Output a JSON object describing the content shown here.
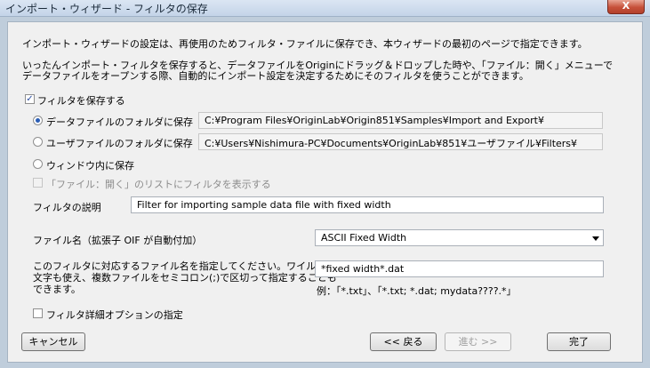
{
  "window": {
    "title": "インポート・ウィザード - フィルタの保存",
    "close_glyph": "X"
  },
  "intro": {
    "line1": "インポート・ウィザードの設定は、再使用のためフィルタ・ファイルに保存でき、本ウィザードの最初のページで指定できます。",
    "line2": "いったんインポート・フィルタを保存すると、データファイルをOriginにドラッグ＆ドロップした時や、「ファイル：開く」メニューで",
    "line3": "データファイルをオープンする際、自動的にインポート設定を決定するためにそのフィルタを使うことができます。"
  },
  "save_filter": {
    "label": "フィルタを保存する",
    "checked": true
  },
  "locations": [
    {
      "label": "データファイルのフォルダに保存",
      "path": "C:¥Program Files¥OriginLab¥Origin851¥Samples¥Import and Export¥",
      "selected": true
    },
    {
      "label": "ユーザファイルのフォルダに保存",
      "path": "C:¥Users¥Nishimura-PC¥Documents¥OriginLab¥851¥ユーザファイル¥Filters¥",
      "selected": false
    },
    {
      "label": "ウィンドウ内に保存",
      "selected": false
    }
  ],
  "show_in_open_list": {
    "label": "「ファイル：開く」のリストにフィルタを表示する",
    "checked": false,
    "enabled": false
  },
  "description": {
    "label": "フィルタの説明",
    "value": "Filter for importing sample data file with fixed width"
  },
  "filename": {
    "label": "ファイル名（拡張子 OIF が自動付加）",
    "value": "ASCII Fixed Width"
  },
  "filename_spec": {
    "help1": "このフィルタに対応するファイル名を指定してください。ワイルドカード",
    "help2": "文字も使え、複数ファイルをセミコロン(;)で区切って指定することも",
    "help3": "できます。",
    "value": "*fixed width*.dat",
    "example": "例：「*.txt」、「*.txt; *.dat; mydata????.*」"
  },
  "advanced": {
    "label": "フィルタ詳細オプションの指定",
    "checked": false
  },
  "buttons": {
    "cancel": "キャンセル",
    "back": "<< 戻る",
    "next": "進む >>",
    "finish": "完了"
  }
}
